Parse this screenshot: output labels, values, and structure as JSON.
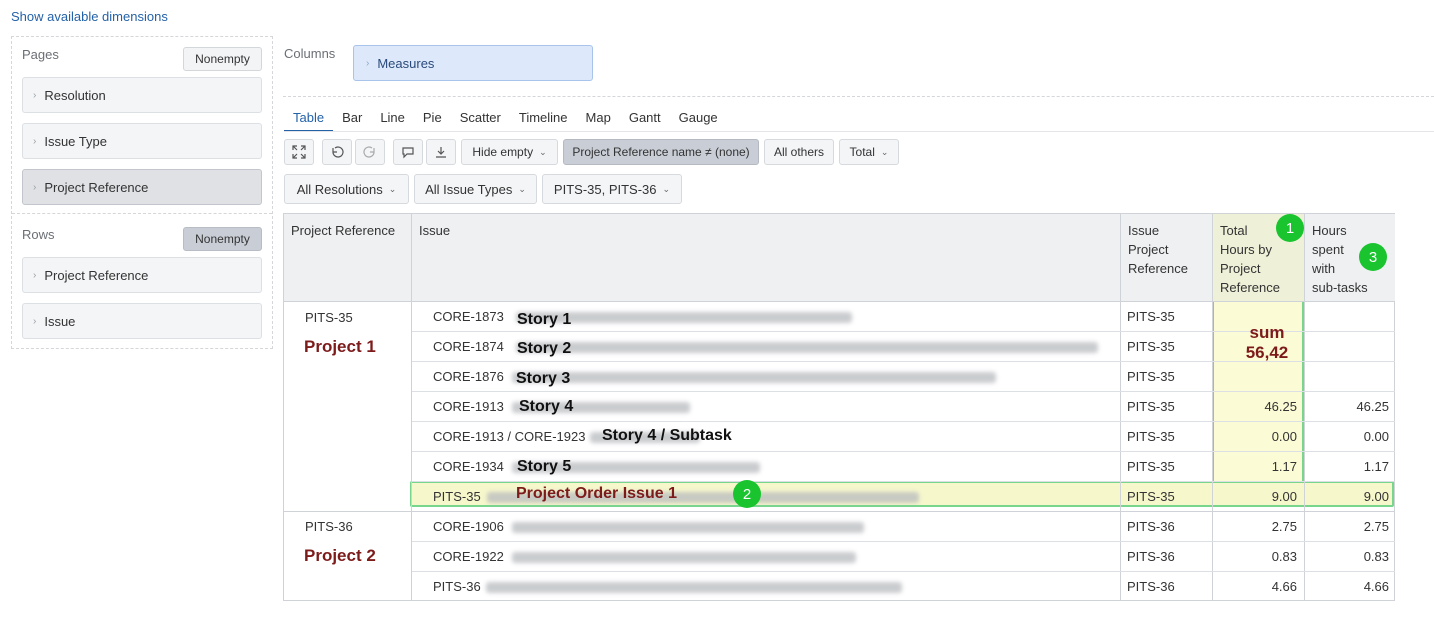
{
  "top_link": "Show available dimensions",
  "left_panel": {
    "pages_label": "Pages",
    "pages_nonempty": "Nonempty",
    "pages_items": [
      "Resolution",
      "Issue Type",
      "Project Reference"
    ],
    "rows_label": "Rows",
    "rows_nonempty": "Nonempty",
    "rows_items": [
      "Project Reference",
      "Issue"
    ]
  },
  "columns": {
    "label": "Columns",
    "measures": "Measures"
  },
  "tabs": [
    "Table",
    "Bar",
    "Line",
    "Pie",
    "Scatter",
    "Timeline",
    "Map",
    "Gantt",
    "Gauge"
  ],
  "active_tab": "Table",
  "toolbar": {
    "hide_empty": "Hide empty",
    "filter": "Project Reference name ≠ (none)",
    "all_others": "All others",
    "total": "Total",
    "icons": [
      "expand-icon",
      "undo-icon",
      "redo-icon",
      "comment-icon",
      "download-icon"
    ]
  },
  "filters": {
    "resolutions": "All Resolutions",
    "issue_types": "All Issue Types",
    "projects": "PITS-35, PITS-36"
  },
  "table": {
    "headers": {
      "project_reference": "Project Reference",
      "issue": "Issue",
      "issue_project_reference": [
        "Issue",
        "Project",
        "Reference"
      ],
      "total_hours": [
        "Total",
        "Hours by",
        "Project",
        "Reference"
      ],
      "hours_subtasks": [
        "Hours",
        "spent",
        "with",
        "sub-tasks"
      ]
    },
    "groups": [
      {
        "id": "PITS-35",
        "name": "Project 1"
      },
      {
        "id": "PITS-36",
        "name": "Project 2"
      }
    ],
    "rows": [
      {
        "issue": "CORE-1873",
        "story": "Story 1",
        "ref": "PITS-35",
        "total": "",
        "sub": ""
      },
      {
        "issue": "CORE-1874",
        "story": "Story 2",
        "ref": "PITS-35",
        "total": "",
        "sub": ""
      },
      {
        "issue": "CORE-1876",
        "story": "Story 3",
        "ref": "PITS-35",
        "total": "",
        "sub": ""
      },
      {
        "issue": "CORE-1913",
        "story": "Story 4",
        "ref": "PITS-35",
        "total": "46.25",
        "sub": "46.25"
      },
      {
        "issue": "CORE-1913 / CORE-1923",
        "story": "Story 4 / Subtask",
        "ref": "PITS-35",
        "total": "0.00",
        "sub": "0.00"
      },
      {
        "issue": "CORE-1934",
        "story": "Story 5",
        "ref": "PITS-35",
        "total": "1.17",
        "sub": "1.17"
      },
      {
        "issue": "PITS-35",
        "story": "Project Order Issue 1",
        "ref": "PITS-35",
        "total": "9.00",
        "sub": "9.00"
      },
      {
        "issue": "CORE-1906",
        "story": "",
        "ref": "PITS-36",
        "total": "2.75",
        "sub": "2.75"
      },
      {
        "issue": "CORE-1922",
        "story": "",
        "ref": "PITS-36",
        "total": "0.83",
        "sub": "0.83"
      },
      {
        "issue": "PITS-36",
        "story": "",
        "ref": "PITS-36",
        "total": "4.66",
        "sub": "4.66"
      }
    ]
  },
  "annotations": {
    "badges": [
      "1",
      "2",
      "3"
    ],
    "sum_label": "sum",
    "sum_value": "56,42",
    "highlight_color": "#77d68c",
    "badge_color": "#19c42f",
    "project_color": "#7d1b1b"
  }
}
